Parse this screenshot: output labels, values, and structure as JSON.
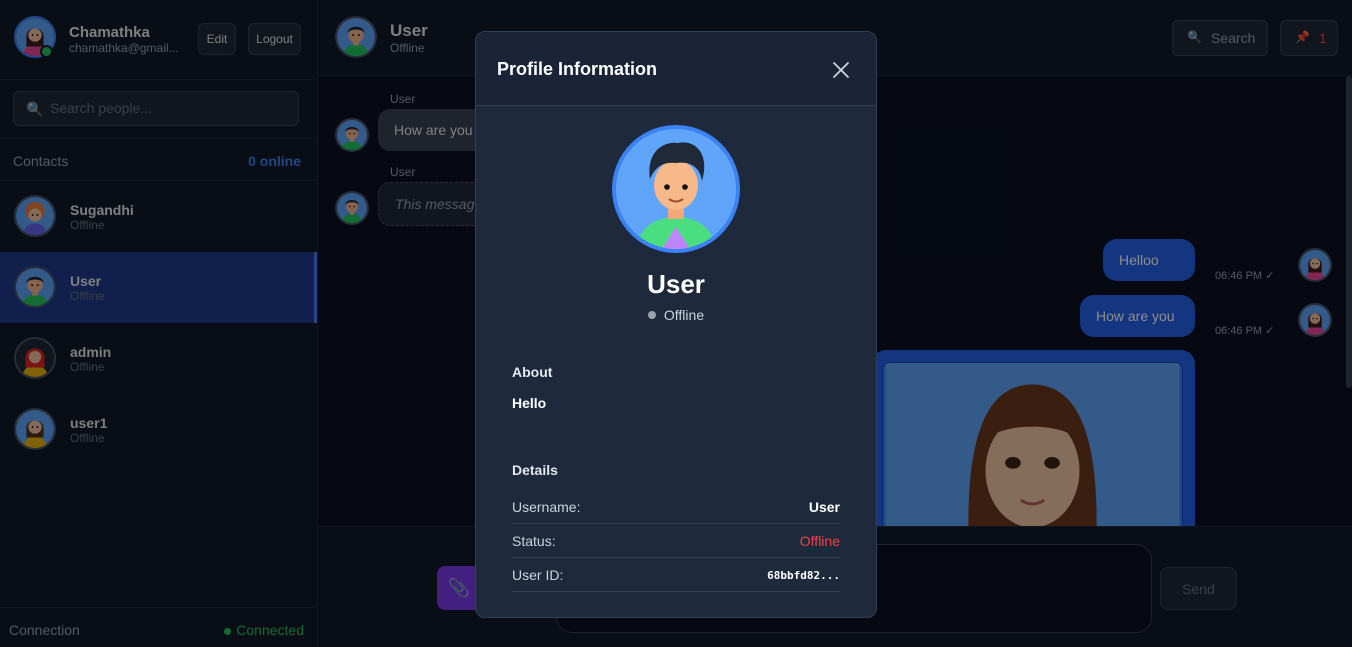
{
  "current_user": {
    "name": "Chamathka",
    "email": "chamathka@gmail...",
    "edit_label": "Edit",
    "logout_label": "Logout"
  },
  "search_people": {
    "placeholder": "Search people...",
    "icon": "search-icon"
  },
  "contacts": {
    "heading": "Contacts",
    "online_count": "0 online",
    "items": [
      {
        "name": "Sugandhi",
        "status": "Offline"
      },
      {
        "name": "User",
        "status": "Offline",
        "active": true
      },
      {
        "name": "admin",
        "status": "Offline"
      },
      {
        "name": "user1",
        "status": "Offline"
      }
    ]
  },
  "connection": {
    "label": "Connection",
    "status": "Connected",
    "status_color": "#22c55e"
  },
  "chat_header": {
    "name": "User",
    "status": "Offline",
    "search_label": "Search",
    "search_icon": "search-icon",
    "pinned_icon": "pin-icon",
    "pinned_count": "1"
  },
  "messages": {
    "incoming": [
      {
        "sender": "User",
        "text": "How are you"
      },
      {
        "sender": "User",
        "text": "This message was deleted"
      }
    ],
    "outgoing": [
      {
        "text": "Helloo",
        "time": "06:46 PM ✓"
      },
      {
        "text": "How are you",
        "time": "06:46 PM ✓"
      }
    ]
  },
  "composer": {
    "attach_icon": "paperclip-icon",
    "send_label": "Send"
  },
  "modal": {
    "title": "Profile Information",
    "close_icon": "close-icon",
    "name": "User",
    "status": "Offline",
    "about_heading": "About",
    "about_text": "Hello",
    "details_heading": "Details",
    "details": {
      "username_label": "Username:",
      "username_value": "User",
      "status_label": "Status:",
      "status_value": "Offline",
      "user_id_label": "User ID:",
      "user_id_value": "68bbfd82..."
    }
  },
  "colors": {
    "accent": "#2563eb",
    "active_contact": "#1e3a8a",
    "offline_red": "#ef4444",
    "attach_purple": "#7c3aed"
  }
}
